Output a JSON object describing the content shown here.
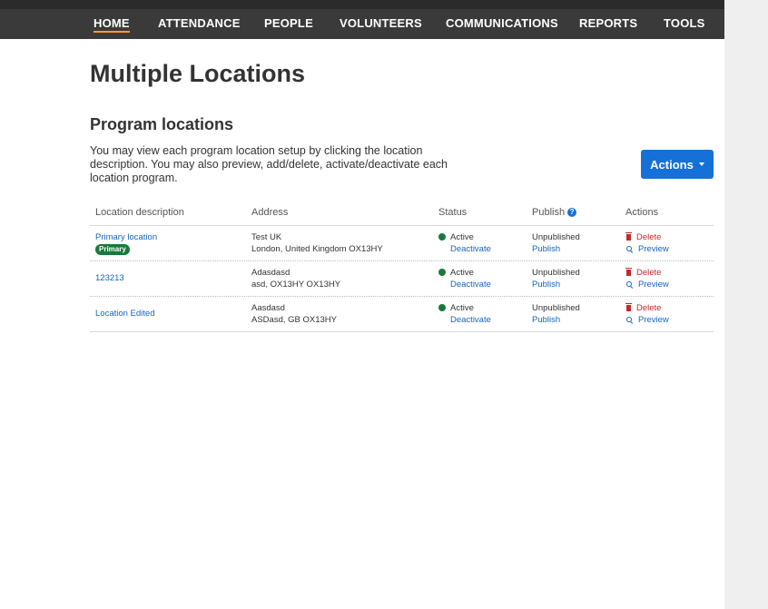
{
  "nav": {
    "items": [
      {
        "label": "HOME"
      },
      {
        "label": "ATTENDANCE"
      },
      {
        "label": "PEOPLE"
      },
      {
        "label": "VOLUNTEERS"
      },
      {
        "label": "COMMUNICATIONS"
      },
      {
        "label": "REPORTS"
      },
      {
        "label": "TOOLS"
      }
    ],
    "active": "HOME",
    "accent_color": "#f0a11e"
  },
  "page": {
    "title": "Multiple Locations",
    "section_title": "Program locations",
    "description": "You may view each program location setup by clicking the location description. You may also preview, add/delete, activate/deactivate each location program.",
    "actions_button": {
      "label": "Actions",
      "icon": "caret-down-icon",
      "color": "#1571d8"
    }
  },
  "table": {
    "headers": {
      "location": "Location description",
      "address": "Address",
      "status": "Status",
      "publish": "Publish",
      "publish_help_icon": "?",
      "actions": "Actions"
    },
    "rows": [
      {
        "location": "Primary location",
        "badge": "Primary",
        "address_line1": "Test UK",
        "address_line2": "London, United Kingdom OX13HY",
        "status": "Active",
        "status_action": "Deactivate",
        "publish_status": "Unpublished",
        "publish_action": "Publish",
        "delete": "Delete",
        "preview": "Preview"
      },
      {
        "location": "123213",
        "address_line1": "Adasdasd",
        "address_line2": "asd, OX13HY OX13HY",
        "status": "Active",
        "status_action": "Deactivate",
        "publish_status": "Unpublished",
        "publish_action": "Publish",
        "delete": "Delete",
        "preview": "Preview"
      },
      {
        "location": "Location Edited",
        "address_line1": "Aasdasd",
        "address_line2": "ASDasd, GB OX13HY",
        "status": "Active",
        "status_action": "Deactivate",
        "publish_status": "Unpublished",
        "publish_action": "Publish",
        "delete": "Delete",
        "preview": "Preview"
      }
    ],
    "status_color": "#177a3a",
    "delete_color": "#c62828",
    "link_color": "#1565c0"
  }
}
